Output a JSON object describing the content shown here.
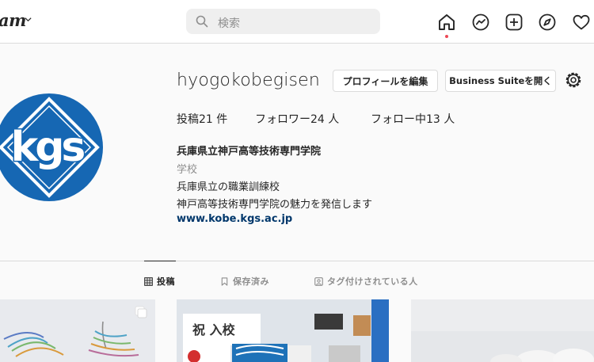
{
  "nav": {
    "logo": "am",
    "search_placeholder": "検索",
    "icons": [
      "home-icon",
      "messenger-icon",
      "new-post-icon",
      "explore-icon",
      "heart-icon"
    ],
    "notification_dot_color": "#ed4956"
  },
  "profile": {
    "username": "hyogokobegisen",
    "edit_profile_label": "プロフィールを編集",
    "business_suite_label": "Business Suiteを開く",
    "avatar_text": "kgs",
    "avatar_color": "#1667b3",
    "stats": {
      "posts_label": "投稿",
      "posts_count": "21",
      "posts_unit": "件",
      "followers_label": "フォロワー",
      "followers_count": "24",
      "followers_unit": "人",
      "following_label": "フォロー中",
      "following_count": "13",
      "following_unit": "人"
    },
    "full_name": "兵庫県立神戸高等技術専門学院",
    "category": "学校",
    "bio_line1": "兵庫県立の職業訓練校",
    "bio_line2": "神戸高等技術専門学院の魅力を発信します",
    "website": "www.kobe.kgs.ac.jp"
  },
  "tabs": [
    {
      "label": "投稿",
      "icon": "grid-icon",
      "active": true
    },
    {
      "label": "保存済み",
      "icon": "bookmark-icon",
      "active": false
    },
    {
      "label": "タグ付けされている人",
      "icon": "tag-person-icon",
      "active": false
    }
  ],
  "posts": {
    "post2_sign_text": "祝 入校"
  }
}
